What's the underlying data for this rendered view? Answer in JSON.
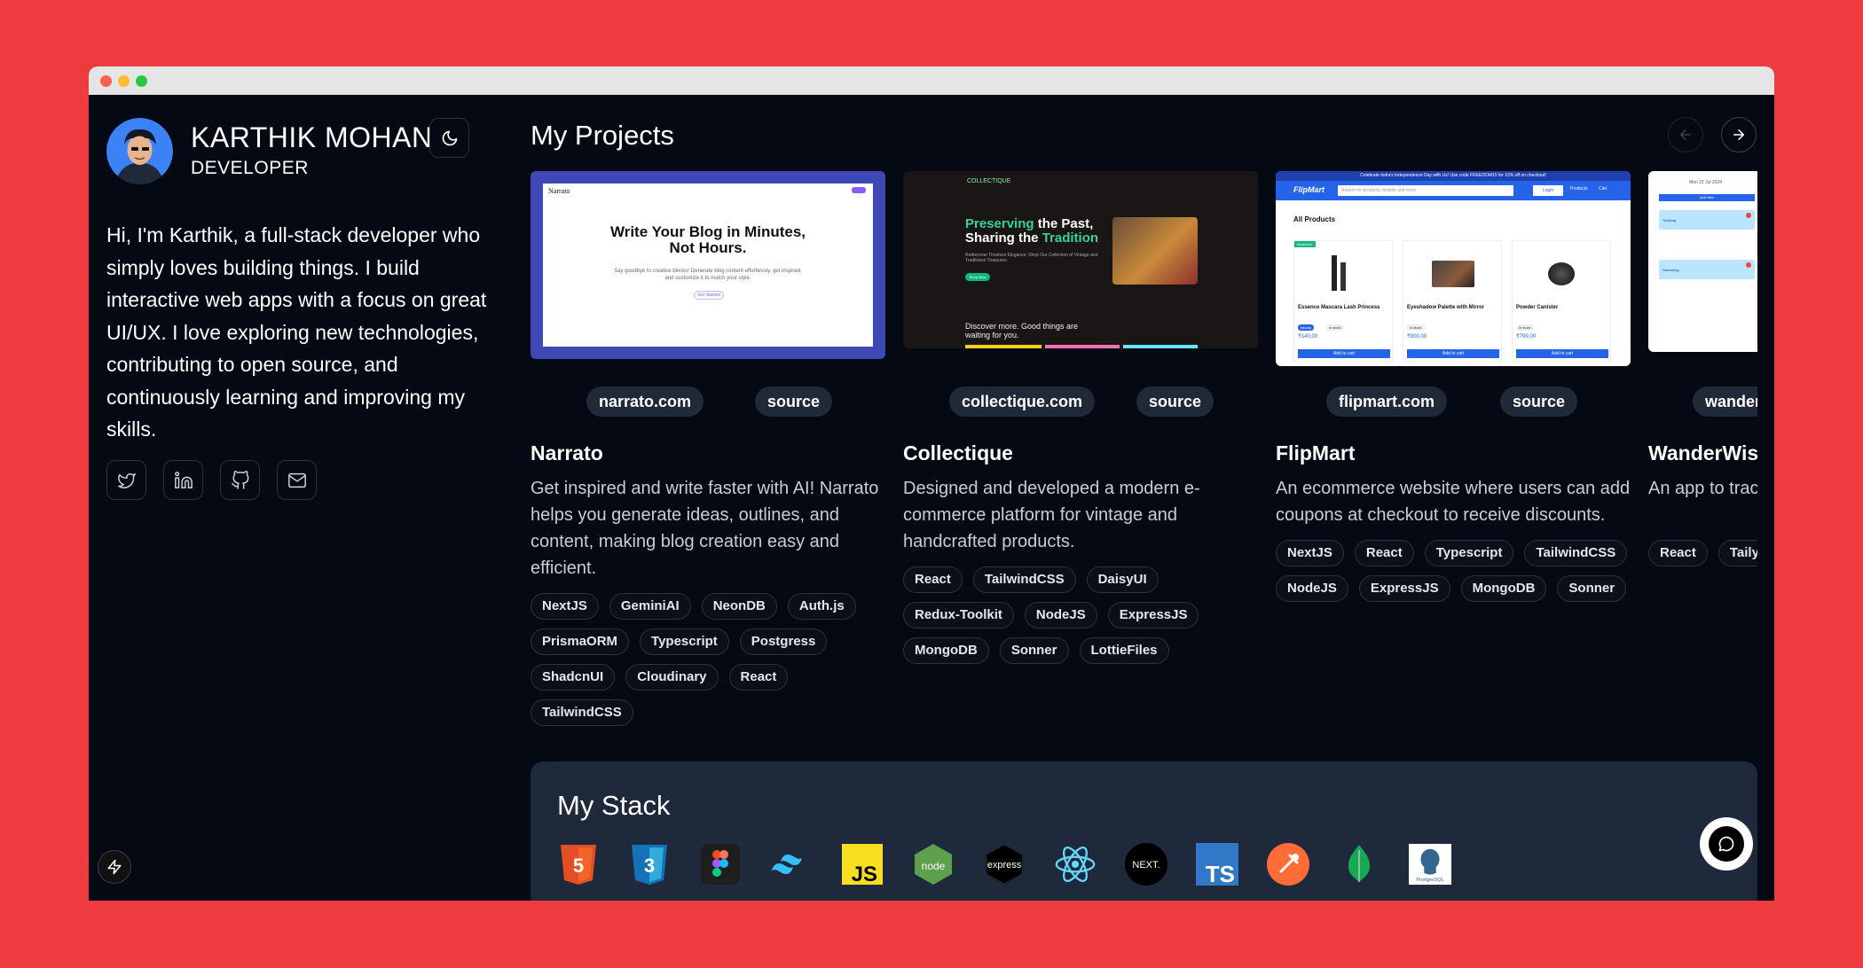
{
  "profile": {
    "name": "KARTHIK MOHAN",
    "role": "DEVELOPER",
    "bio": "Hi, I'm Karthik, a full-stack developer who simply loves building things. I build interactive web apps with a focus on great UI/UX. I love exploring new technologies, contributing to open source, and continuously learning and improving my skills.",
    "socials": [
      "twitter-icon",
      "linkedin-icon",
      "github-icon",
      "mail-icon"
    ]
  },
  "projects_section": {
    "title": "My Projects"
  },
  "projects": [
    {
      "title": "Narrato",
      "site": "narrato.com",
      "source": "source",
      "description": "Get inspired and write faster with AI! Narrato helps you generate ideas, outlines, and content, making blog creation easy and efficient.",
      "tags": [
        "NextJS",
        "GeminiAI",
        "NeonDB",
        "Auth.js",
        "PrismaORM",
        "Typescript",
        "Postgress",
        "ShadcnUI",
        "Cloudinary",
        "React",
        "TailwindCSS"
      ],
      "preview": {
        "logo": "Narrato",
        "heading": "Write Your Blog in Minutes, Not Hours.",
        "sub": "Say goodbye to creative blocks! Generate blog content effortlessly, get inspired, and customize it to match your style.",
        "cta": "Get Started"
      }
    },
    {
      "title": "Collectique",
      "site": "collectique.com",
      "source": "source",
      "description": "Designed and developed a modern e-commerce platform for vintage and handcrafted products.",
      "tags": [
        "React",
        "TailwindCSS",
        "DaisyUI",
        "Redux-Toolkit",
        "NodeJS",
        "ExpressJS",
        "MongoDB",
        "Sonner",
        "LottieFiles"
      ],
      "preview": {
        "logo": "COLLECTIQUE",
        "heading_a": "Preserving",
        "heading_b": " the Past,",
        "heading_c": "Sharing the ",
        "heading_d": "Tradition",
        "sub": "Rediscover Timeless Elegance: Shop Our Collection of Vintage and Traditional Treasures.",
        "cta": "Shop Now",
        "footer": "Discover more. Good things are waiting for you."
      }
    },
    {
      "title": "FlipMart",
      "site": "flipmart.com",
      "source": "source",
      "description": "An ecommerce website where users can add coupons at checkout to receive discounts.",
      "tags": [
        "NextJS",
        "React",
        "Typescript",
        "TailwindCSS",
        "NodeJS",
        "ExpressJS",
        "MongoDB",
        "Sonner"
      ],
      "preview": {
        "banner": "Celebrate India's Independence Day with Us! Use code FREEDOM15 for 15% off on checkout!",
        "logo": "FlipMart",
        "search": "Search for products, brands and more",
        "login": "Login",
        "products": "Products",
        "cart": "Cart",
        "heading": "All Products",
        "badge": "Bestseller",
        "cart_btn": "Add to cart",
        "items": [
          {
            "name": "Essence Mascara Lash Princess",
            "tag": "beauty",
            "stock": "in stock",
            "price": "₹140.00"
          },
          {
            "name": "Eyeshadow Palette with Mirror",
            "stock": "in stock",
            "price": "₹900.00"
          },
          {
            "name": "Powder Canister",
            "stock": "in stock",
            "price": "₹799.00"
          }
        ]
      }
    },
    {
      "title": "WanderWis",
      "site": "wander",
      "description": "An app to trac effortlessly.",
      "tags": [
        "React",
        "Taily"
      ],
      "preview": {
        "date": "Mon 22 Jul 2024",
        "add": "Add New",
        "item1": "Trekking",
        "item2": "Swimming"
      }
    }
  ],
  "stack": {
    "title": "My Stack",
    "icons": [
      "html5-icon",
      "css3-icon",
      "figma-icon",
      "tailwind-icon",
      "javascript-icon",
      "nodejs-icon",
      "express-icon",
      "react-icon",
      "nextjs-icon",
      "typescript-icon",
      "postman-icon",
      "mongodb-icon",
      "postgresql-icon"
    ],
    "labels": {
      "js": "JS",
      "node": "node",
      "express": "express",
      "next": "NEXT.",
      "ts": "TS",
      "pg": "PostgreSQL",
      "html": "5",
      "css": "3"
    }
  },
  "colors": {
    "background": "#EE3B3F",
    "window": "#050914",
    "pill": "#1F2937",
    "stack_bg": "#1E293B"
  }
}
